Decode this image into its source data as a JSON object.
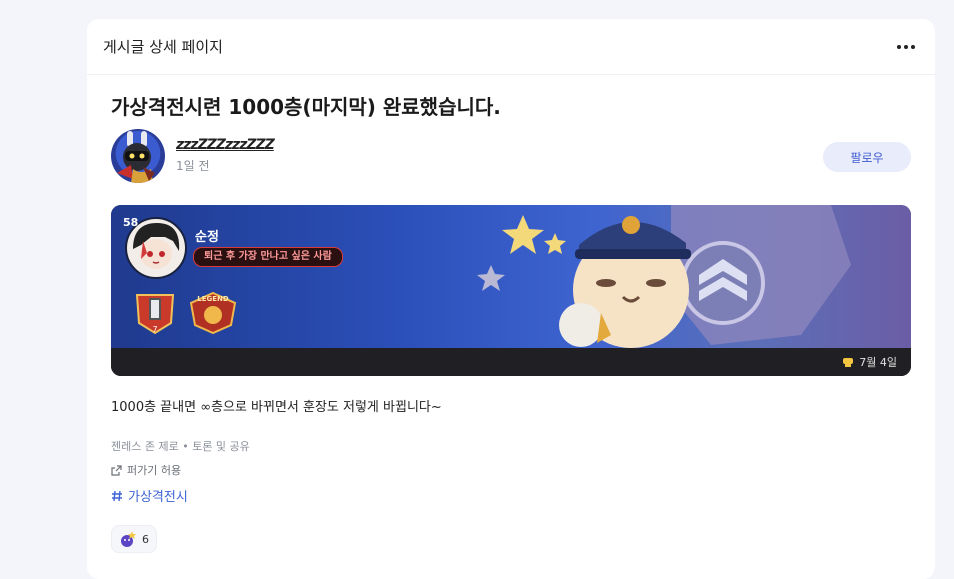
{
  "header": {
    "title": "게시글 상세 페이지",
    "more_icon": "more-horizontal-icon"
  },
  "post": {
    "title": "가상격전시련 1000층(마지막) 완료했습니다.",
    "author": {
      "name": "zzzZZZzzzZZZ",
      "time": "1일 전"
    },
    "follow_label": "팔로우",
    "banner": {
      "level": "58",
      "character_name": "순정",
      "character_title": "퇴근 후 가장 만나고 싶은 사람",
      "emblem2_text": "LEGEND",
      "date": "7월 4일"
    },
    "body": "1000층 끝내면 ∞층으로 바뀌면서 훈장도 저렇게 바뀝니다~",
    "category": "젠레스 존 제로 • 토론 및 공유",
    "share_label": "퍼가기 허용",
    "tag": "가상격전시",
    "reaction_count": "6"
  },
  "colors": {
    "accent": "#3e63d6",
    "follow_bg": "#e8ecfb",
    "banner_blue": "#2b4fb8"
  }
}
